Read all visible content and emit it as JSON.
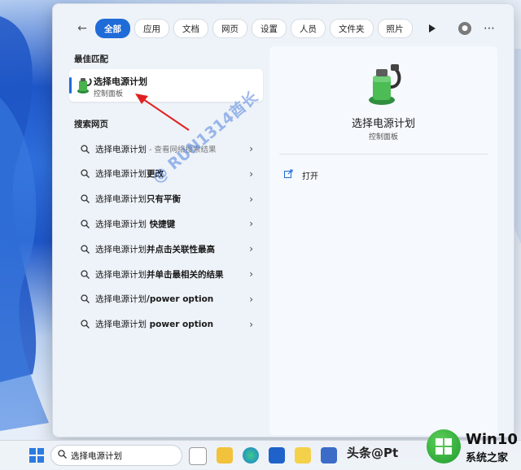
{
  "tabs": [
    "全部",
    "应用",
    "文档",
    "网页",
    "设置",
    "人员",
    "文件夹",
    "照片"
  ],
  "best_match": {
    "section_title": "最佳匹配",
    "title": "选择电源计划",
    "subtitle": "控制面板"
  },
  "web": {
    "section_title": "搜索网页",
    "results": [
      {
        "base": "选择电源计划",
        "bold": "",
        "gray": " - 查看网络搜索结果"
      },
      {
        "base": "选择电源计划",
        "bold": "更改",
        "gray": ""
      },
      {
        "base": "选择电源计划",
        "bold": "只有平衡",
        "gray": ""
      },
      {
        "base": "选择电源计划",
        "bold": " 快捷键",
        "gray": ""
      },
      {
        "base": "选择电源计划",
        "bold": "并点击关联性最高",
        "gray": ""
      },
      {
        "base": "选择电源计划",
        "bold": "并单击最相关的结果",
        "gray": ""
      },
      {
        "base": "选择电源计划",
        "bold": "/power option",
        "gray": ""
      },
      {
        "base": "选择电源计划",
        "bold": " power option",
        "gray": ""
      }
    ]
  },
  "preview": {
    "title": "选择电源计划",
    "subtitle": "控制面板",
    "open_label": "打开"
  },
  "watermark": "@ RUN1314酋长",
  "taskbar": {
    "search_value": "选择电源计划",
    "text_badge": "头条@Pt"
  },
  "site_logo": {
    "line1": "Win10",
    "line2": "系统之家"
  },
  "colors": {
    "accent": "#1f6cd8",
    "arrow": "#e02020"
  }
}
